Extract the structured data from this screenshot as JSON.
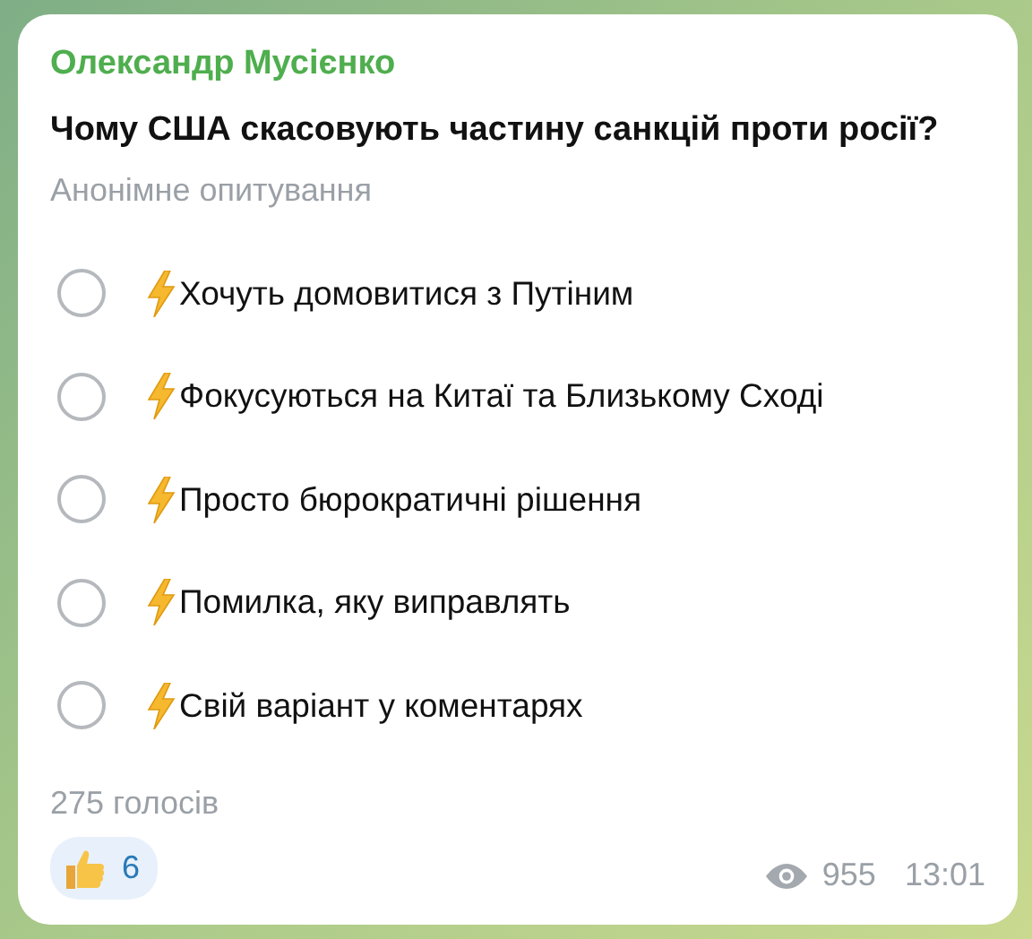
{
  "message": {
    "author": "Олександр Мусієнко",
    "question": "Чому США скасовують частину санкцій проти росії?",
    "poll_type": "Анонімне опитування",
    "options": [
      {
        "text": "Хочуть домовитися з Путіним",
        "selected": false
      },
      {
        "text": "Фокусуються на Китаї та Близькому Сході",
        "selected": false
      },
      {
        "text": "Просто бюрократичні рішення",
        "selected": false
      },
      {
        "text": "Помилка, яку виправлять",
        "selected": false
      },
      {
        "text": "Свій варіант у коментарях",
        "selected": false
      }
    ],
    "votes": "275 голосів",
    "reactions": [
      {
        "count": "6",
        "selected": false
      }
    ],
    "views": "955",
    "time": "13:01"
  }
}
